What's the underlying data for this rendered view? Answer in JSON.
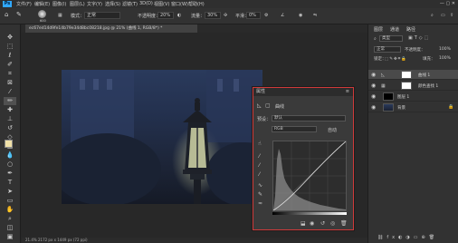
{
  "menubar": {
    "logo": "Ps",
    "items": [
      "文件(F)",
      "编辑(E)",
      "图像(I)",
      "图层(L)",
      "文字(Y)",
      "选择(S)",
      "滤镜(T)",
      "3D(D)",
      "视图(V)",
      "窗口(W)",
      "帮助(H)"
    ],
    "window_controls": "—  ▢  ✕"
  },
  "options": {
    "brush_size": "600",
    "mode_label": "模式：",
    "mode_value": "正常",
    "opacity_label": "不透明度：",
    "opacity_value": "20%",
    "flow_label": "流量：",
    "flow_value": "30%",
    "smooth_label": "平滑：",
    "smooth_value": "0%"
  },
  "document": {
    "tab_title": "ec67ed14d9fe14b79e34d8bc08218.jpg @ 21% (曲线 1, RGB/8*) *",
    "status": "21.4%     2172 px x 1449 px (72 ppi)"
  },
  "properties": {
    "title": "属性",
    "type_label": "曲线",
    "preset_label": "预设：",
    "preset_value": "默认",
    "channel_value": "RGB",
    "auto_label": "自动"
  },
  "layers_panel": {
    "tabs": [
      "图层",
      "通道",
      "路径"
    ],
    "kind_label": "类型",
    "blend_value": "正常",
    "opacity_label": "不透明度：",
    "opacity_value": "100%",
    "lock_label": "锁定：",
    "fill_label": "填充：",
    "fill_value": "100%",
    "layers": [
      {
        "name": "曲线 1"
      },
      {
        "name": "颜色查找 1"
      },
      {
        "name": "图层 1"
      },
      {
        "name": "背景"
      }
    ]
  }
}
